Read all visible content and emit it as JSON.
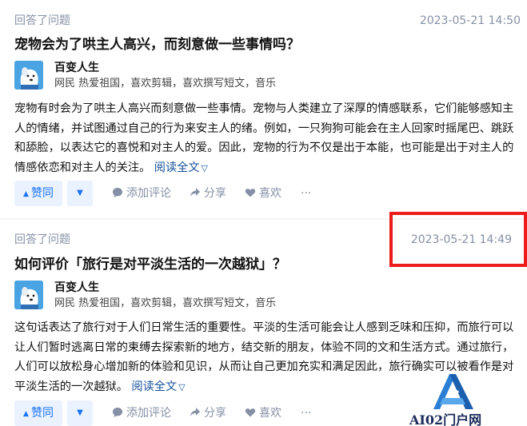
{
  "feed": [
    {
      "type_label": "回答了问题",
      "time": "2023-05-21 14:50",
      "title": "宠物会为了哄主人高兴，而刻意做一些事情吗？",
      "author_name": "百变人生",
      "author_bio": "网民 热爱祖国，喜欢剪辑，喜欢撰写短文，音乐",
      "content": "宠物有时会为了哄主人高兴而刻意做一些事情。宠物与人类建立了深厚的情感联系，它们能够感知主人的情绪，并试图通过自己的行为来安主人的绪。例如，一只狗狗可能会在主人回家时摇尾巴、跳跃和舔脸，以表达它的喜悦和对主人的爱。因此，宠物的行为不仅是出于本能，也可能是出于对主人的情感依恋和对主人的关注。",
      "read_more": "阅读全文",
      "vote_label": "赞同",
      "comment_label": "添加评论",
      "share_label": "分享",
      "like_label": "喜欢",
      "more_label": "···"
    },
    {
      "type_label": "回答了问题",
      "time": "2023-05-21 14:49",
      "title": "如何评价「旅行是对平淡生活的一次越狱」？",
      "author_name": "百变人生",
      "author_bio": "网民 热爱祖国，喜欢剪辑，喜欢撰写短文，音乐",
      "content": "这句话表达了旅行对于人们日常生活的重要性。平淡的生活可能会让人感到乏味和压抑，而旅行可以让人们暂时逃离日常的束缚去探索新的地方，结交新的朋友，体验不同的文和生活方式。通过旅行，人们可以放松身心增加新的体验和见识，从而让自己更加充实和满足因此，旅行确实可以被看作是对平淡生活的一次越狱。",
      "read_more": "阅读全文",
      "vote_label": "赞同",
      "comment_label": "添加评论",
      "share_label": "分享",
      "like_label": "喜欢",
      "more_label": "···"
    }
  ],
  "watermark": {
    "text": "AI02门户网"
  },
  "colors": {
    "accent": "#1772f6",
    "muted": "#8590a6",
    "link": "#175199",
    "highlight_box": "#ee1b1b"
  },
  "icons": [
    "avatar-dog-icon",
    "triangle-up-icon",
    "triangle-down-icon",
    "comment-bubble-icon",
    "share-arrow-icon",
    "heart-icon",
    "more-dots-icon",
    "chevron-down-icon"
  ]
}
